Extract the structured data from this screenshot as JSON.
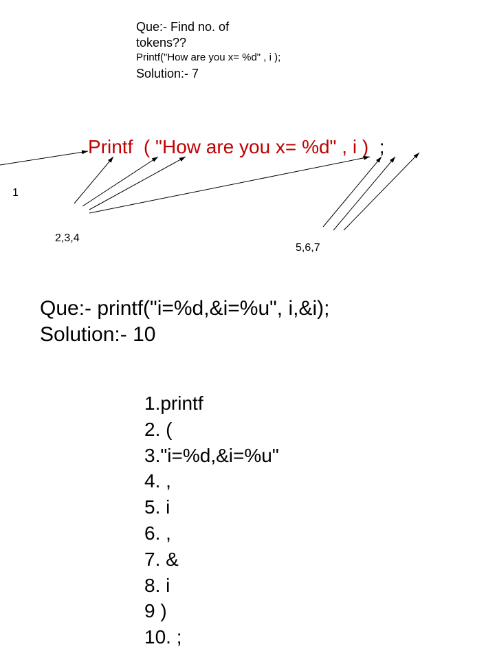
{
  "q1": {
    "line1": "Que:- Find no. of",
    "line2": "tokens??",
    "code": "Printf(\"How are you x= %d\" , i );",
    "solution": "Solution:- 7"
  },
  "printf": {
    "t1": "Printf",
    "t2": "(",
    "t3": "\"How are you x= %d\"",
    "t4": ",",
    "t5": "i",
    "t6": ")",
    "t7": ";"
  },
  "labels": {
    "l1": "1",
    "l234": "2,3,4",
    "l567": "5,6,7"
  },
  "q2": {
    "que": "Que:- printf(\"i=%d,&i=%u\", i,&i);",
    "sol": "Solution:- 10"
  },
  "tokens": {
    "t1": "1.printf",
    "t2": "2. (",
    "t3": "3.\"i=%d,&i=%u\"",
    "t4": "4. ,",
    "t5": "5. i",
    "t6": "6. ,",
    "t7": "7. &",
    "t8": "8. i",
    "t9": "9 )",
    "t10": "10. ;"
  }
}
